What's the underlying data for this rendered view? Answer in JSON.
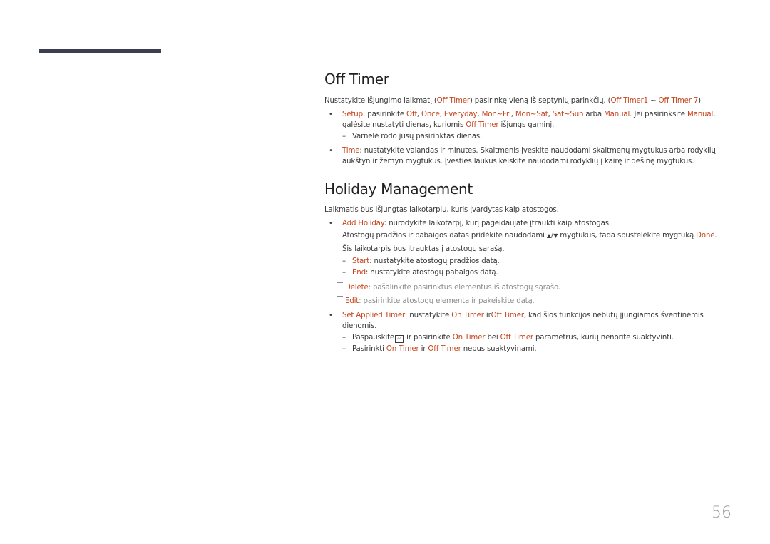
{
  "off_timer": {
    "title": "Off Timer",
    "intro": {
      "pre": "Nustatykite išjungimo laikmatį (",
      "hl1": "Off Timer",
      "mid": ") pasirinkę vieną iš septynių parinkčių. (",
      "hl2": "Off Timer1",
      "sep": " ~ ",
      "hl3": "Off Timer 7",
      "post": ")"
    },
    "setup": {
      "label": "Setup",
      "t1": ": pasirinkite ",
      "opt_off": "Off",
      "c1": ", ",
      "opt_once": "Once",
      "c2": ", ",
      "opt_everyday": "Everyday",
      "c3": ", ",
      "opt_monfri": "Mon~Fri",
      "c4": ", ",
      "opt_monsat": "Mon~Sat",
      "c5": ", ",
      "opt_satsun": "Sat~Sun",
      "t2": " arba ",
      "opt_manual": "Manual",
      "t3": ". Jei pasirinksite ",
      "opt_manual2": "Manual",
      "t4": ",",
      "line2_pre": "galėsite nustatyti dienas, kuriomis ",
      "line2_hl": "Off Timer",
      "line2_post": " išjungs gaminį.",
      "sub": "Varnelė rodo jūsų pasirinktas dienas."
    },
    "time": {
      "label": "Time",
      "line1": ": nustatykite valandas ir minutes. Skaitmenis įveskite naudodami skaitmenų mygtukus arba rodyklių",
      "line2": "aukštyn ir žemyn mygtukus. Įvesties laukus keiskite naudodami rodyklių į kairę ir dešinę mygtukus."
    }
  },
  "holiday": {
    "title": "Holiday Management",
    "intro": "Laikmatis bus išjungtas laikotarpiu, kuris įvardytas kaip atostogos.",
    "add": {
      "label": "Add Holiday",
      "line1": ": nurodykite laikotarpį, kurį pageidaujate įtraukti kaip atostogas.",
      "line2_pre": "Atostogų pradžios ir pabaigos datas pridėkite naudodami ",
      "up": "▲",
      "slash": "/",
      "down": "▼",
      "line2_mid": " mygtukus, tada spustelėkite mygtuką ",
      "done": "Done",
      "line2_post": ".",
      "line3": "Šis laikotarpis bus įtrauktas į atostogų sąrašą.",
      "start_label": "Start",
      "start_text": ": nustatykite atostogų pradžios datą.",
      "end_label": "End",
      "end_text": ": nustatykite atostogų pabaigos datą."
    },
    "delete": {
      "label": "Delete",
      "text": ": pašalinkite pasirinktus elementus iš atostogų sąrašo."
    },
    "edit": {
      "label": "Edit",
      "text": ": pasirinkite atostogų elementą ir pakeiskite datą."
    },
    "applied": {
      "label": "Set Applied Timer",
      "t1": ": nustatykite ",
      "on": "On Timer",
      "t2": " ir",
      "off": "Off Timer",
      "t3": ", kad šios funkcijos nebūtų įjungiamos šventinėmis",
      "line2": "dienomis.",
      "sub1_pre": "Paspauskite",
      "sub1_mid": " ir pasirinkite ",
      "sub1_on": "On Timer",
      "sub1_bei": " bei ",
      "sub1_off": "Off Timer",
      "sub1_post": " parametrus, kurių nenorite suaktyvinti.",
      "sub2_pre": "Pasirinkti ",
      "sub2_on": "On Timer",
      "sub2_ir": " ir ",
      "sub2_off": "Off Timer",
      "sub2_post": " nebus suaktyvinami."
    }
  },
  "glyphs": {
    "bullet": "•",
    "dash": "–",
    "enter": "⏎"
  },
  "page_number": "56"
}
